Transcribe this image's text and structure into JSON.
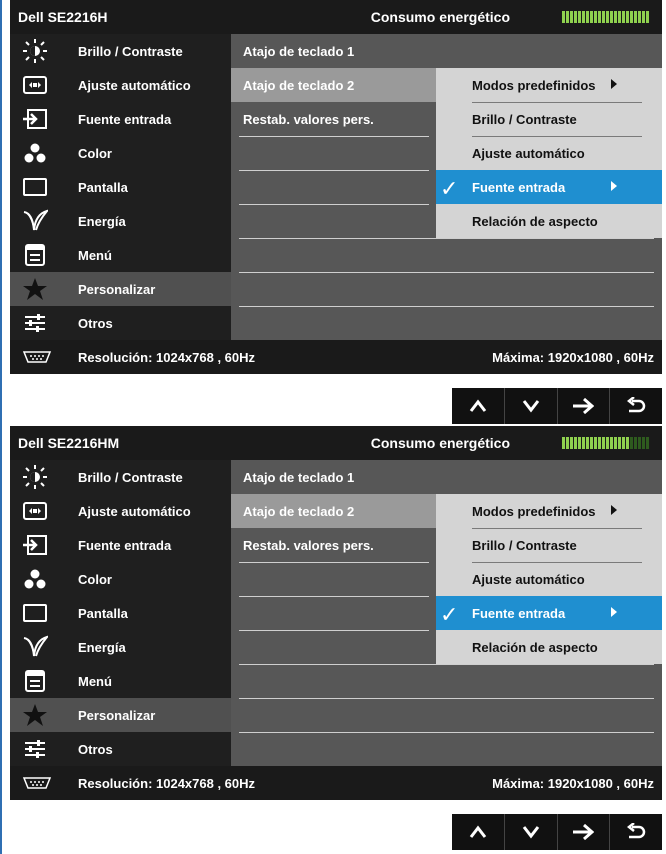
{
  "osd_panels": [
    {
      "model": "Dell SE2216H",
      "energy_label": "Consumo energético",
      "energy_level_fraction": 1.0,
      "sidebar": [
        {
          "label": "Brillo / Contraste",
          "icon": "brightness-icon"
        },
        {
          "label": "Ajuste automático",
          "icon": "auto-adjust-icon"
        },
        {
          "label": "Fuente entrada",
          "icon": "input-source-icon"
        },
        {
          "label": "Color",
          "icon": "color-icon"
        },
        {
          "label": "Pantalla",
          "icon": "display-icon"
        },
        {
          "label": "Energía",
          "icon": "energy-icon"
        },
        {
          "label": "Menú",
          "icon": "menu-icon"
        },
        {
          "label": "Personalizar",
          "icon": "star-icon",
          "active": true
        },
        {
          "label": "Otros",
          "icon": "others-icon"
        }
      ],
      "submenu": [
        {
          "label": "Atajo de teclado 1"
        },
        {
          "label": "Atajo de teclado 2",
          "active": true
        },
        {
          "label": "Restab. valores pers."
        }
      ],
      "shortcut_options": [
        {
          "label": "Modos predefinidos",
          "has_arrow": true
        },
        {
          "label": "Brillo / Contraste"
        },
        {
          "label": "Ajuste automático"
        },
        {
          "label": "Fuente entrada",
          "has_arrow": true,
          "selected": true
        },
        {
          "label": "Relación de aspecto"
        }
      ],
      "resolution": "Resolución: 1024x768 , 60Hz",
      "max_resolution": "Máxima: 1920x1080 , 60Hz"
    },
    {
      "model": "Dell SE2216HM",
      "energy_label": "Consumo energético",
      "energy_level_fraction": 0.78,
      "sidebar": [
        {
          "label": "Brillo / Contraste",
          "icon": "brightness-icon"
        },
        {
          "label": "Ajuste automático",
          "icon": "auto-adjust-icon"
        },
        {
          "label": "Fuente entrada",
          "icon": "input-source-icon"
        },
        {
          "label": "Color",
          "icon": "color-icon"
        },
        {
          "label": "Pantalla",
          "icon": "display-icon"
        },
        {
          "label": "Energía",
          "icon": "energy-icon"
        },
        {
          "label": "Menú",
          "icon": "menu-icon"
        },
        {
          "label": "Personalizar",
          "icon": "star-icon",
          "active": true
        },
        {
          "label": "Otros",
          "icon": "others-icon"
        }
      ],
      "submenu": [
        {
          "label": "Atajo de teclado 1"
        },
        {
          "label": "Atajo de teclado 2",
          "active": true
        },
        {
          "label": "Restab. valores pers."
        }
      ],
      "shortcut_options": [
        {
          "label": "Modos predefinidos",
          "has_arrow": true
        },
        {
          "label": "Brillo / Contraste"
        },
        {
          "label": "Ajuste automático"
        },
        {
          "label": "Fuente entrada",
          "has_arrow": true,
          "selected": true
        },
        {
          "label": "Relación de aspecto"
        }
      ],
      "resolution": "Resolución: 1024x768 , 60Hz",
      "max_resolution": "Máxima: 1920x1080 , 60Hz"
    }
  ],
  "nav_buttons": [
    {
      "icon": "up-arrow-icon"
    },
    {
      "icon": "down-arrow-icon"
    },
    {
      "icon": "right-arrow-icon"
    },
    {
      "icon": "back-icon"
    }
  ],
  "colors": {
    "selection_blue": "#1f8fd0",
    "energy_on": "#8fd14f",
    "energy_off": "#2e5a1e"
  }
}
